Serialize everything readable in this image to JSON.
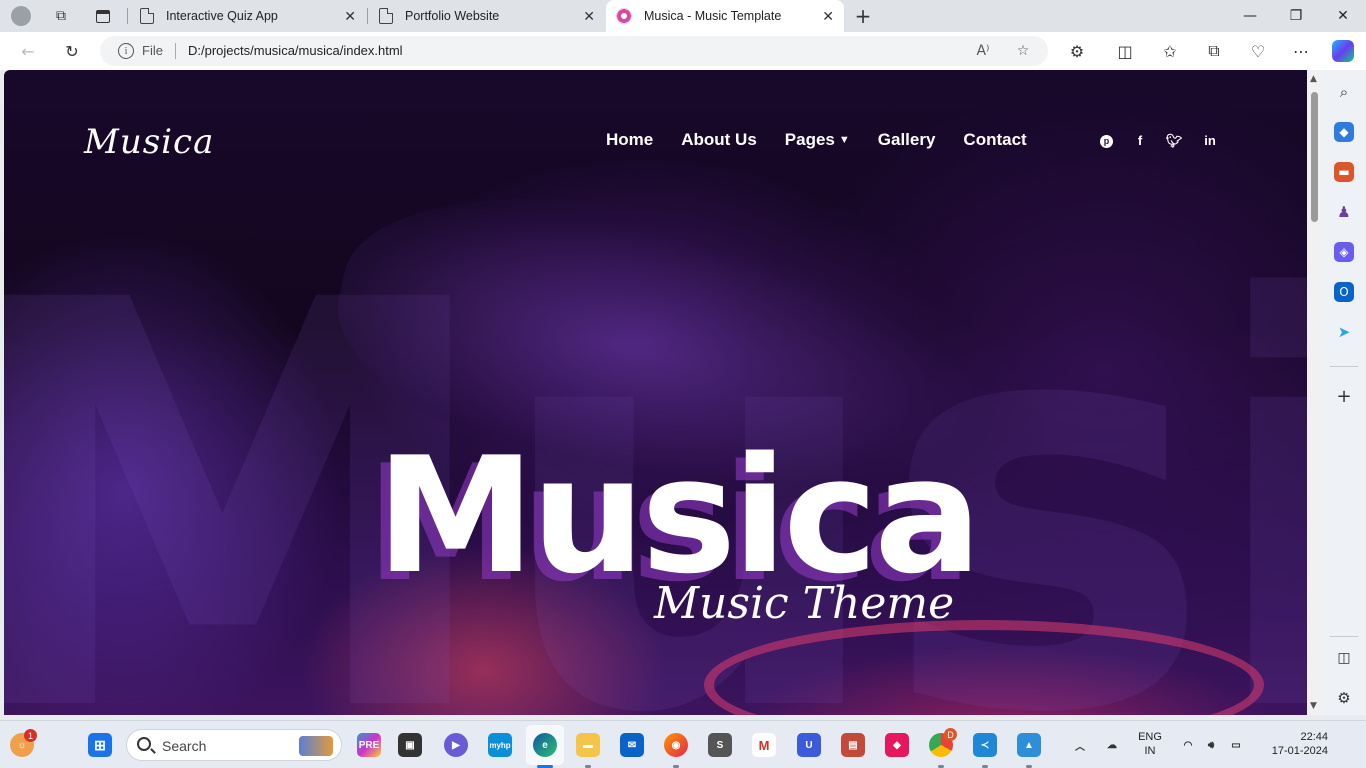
{
  "browser": {
    "tabs": [
      {
        "title": "Interactive Quiz App",
        "active": false
      },
      {
        "title": "Portfolio Website",
        "active": false
      },
      {
        "title": "Musica - Music Template",
        "active": true
      }
    ],
    "address": {
      "scheme_label": "File",
      "url": "D:/projects/musica/musica/index.html"
    }
  },
  "site": {
    "logo": "Musica",
    "nav": [
      {
        "label": "Home"
      },
      {
        "label": "About Us"
      },
      {
        "label": "Pages"
      },
      {
        "label": "Gallery"
      },
      {
        "label": "Contact"
      }
    ],
    "social_icons": [
      "pinterest-icon",
      "facebook-icon",
      "twitter-icon",
      "linkedin-icon"
    ],
    "background_text": "Music",
    "hero": {
      "title": "Musica",
      "subtitle": "Music Theme"
    }
  },
  "taskbar": {
    "search_placeholder": "Search",
    "notification_count": "1",
    "chrome_badge": "D",
    "language": "ENG",
    "region": "IN",
    "time": "22:44",
    "date": "17-01-2024"
  },
  "colors": {
    "accent_purple": "#3c145e",
    "edge_blue": "#1a73e8"
  }
}
